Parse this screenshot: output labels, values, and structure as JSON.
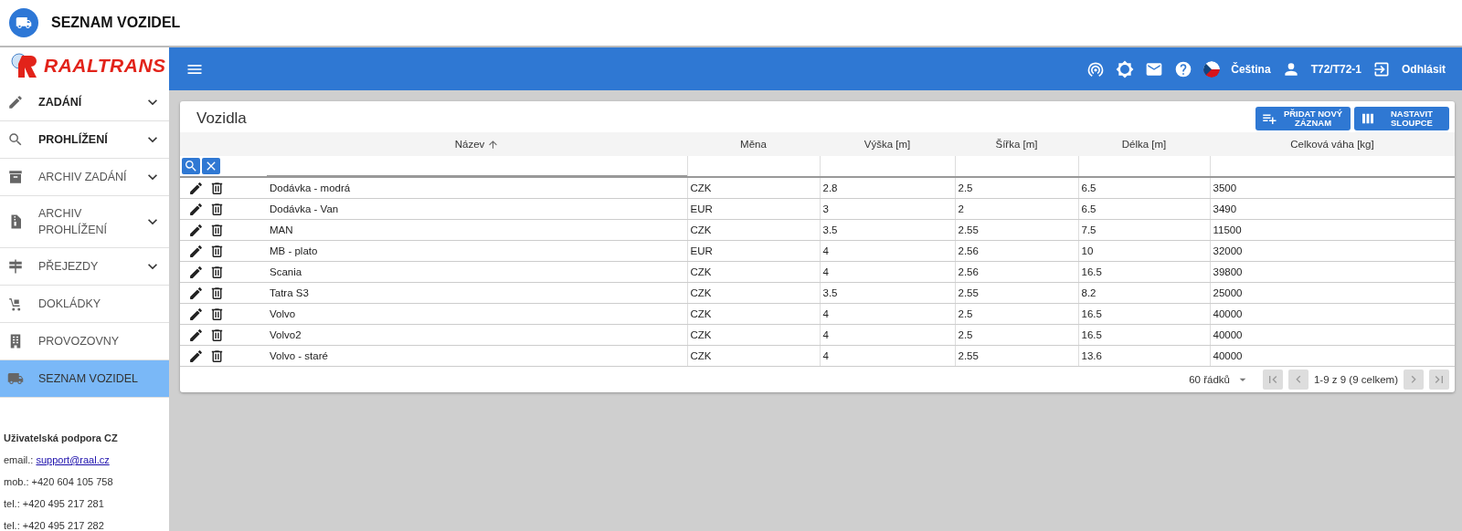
{
  "app_header": {
    "title": "SEZNAM VOZIDEL"
  },
  "sidebar": {
    "logo": "RAALTRANS",
    "items": [
      {
        "label": "ZADÁNÍ",
        "bold": true,
        "expandable": true,
        "selected": false
      },
      {
        "label": "PROHLÍŽENÍ",
        "bold": true,
        "expandable": true,
        "selected": false
      },
      {
        "label": "ARCHIV ZADÁNÍ",
        "bold": false,
        "expandable": true,
        "selected": false
      },
      {
        "label": "ARCHIV PROHLÍŽENÍ",
        "bold": false,
        "expandable": true,
        "selected": false
      },
      {
        "label": "PŘEJEZDY",
        "bold": false,
        "expandable": true,
        "selected": false
      },
      {
        "label": "DOKLÁDKY",
        "bold": false,
        "expandable": false,
        "selected": false
      },
      {
        "label": "PROVOZOVNY",
        "bold": false,
        "expandable": false,
        "selected": false
      },
      {
        "label": "SEZNAM VOZIDEL",
        "bold": false,
        "expandable": false,
        "selected": true
      }
    ],
    "support": {
      "title": "Uživatelská podpora CZ",
      "email_label": "email.:",
      "email": "support@raal.cz",
      "lines": [
        "mob.: +420 604 105 758",
        "tel.: +420 495 217 281",
        "tel.: +420 495 217 282"
      ]
    }
  },
  "topbar": {
    "language": "Čeština",
    "user": "T72/T72-1",
    "logout": "Odhlásit"
  },
  "card": {
    "title": "Vozidla",
    "buttons": [
      {
        "label": "PŘIDAT NOVÝ ZÁZNAM"
      },
      {
        "label": "NASTAVIT SLOUPCE"
      }
    ]
  },
  "table": {
    "columns": [
      {
        "label": "Název",
        "sorted": true
      },
      {
        "label": "Měna",
        "sorted": false
      },
      {
        "label": "Výška [m]",
        "sorted": false
      },
      {
        "label": "Šířka [m]",
        "sorted": false
      },
      {
        "label": "Délka [m]",
        "sorted": false
      },
      {
        "label": "Celková váha [kg]",
        "sorted": false
      }
    ],
    "rows": [
      [
        "Dodávka - modrá",
        "CZK",
        "2.8",
        "2.5",
        "6.5",
        "3500"
      ],
      [
        "Dodávka - Van",
        "EUR",
        "3",
        "2",
        "6.5",
        "3490"
      ],
      [
        "MAN",
        "CZK",
        "3.5",
        "2.55",
        "7.5",
        "11500"
      ],
      [
        "MB - plato",
        "EUR",
        "4",
        "2.56",
        "10",
        "32000"
      ],
      [
        "Scania",
        "CZK",
        "4",
        "2.56",
        "16.5",
        "39800"
      ],
      [
        "Tatra S3",
        "CZK",
        "3.5",
        "2.55",
        "8.2",
        "25000"
      ],
      [
        "Volvo",
        "CZK",
        "4",
        "2.5",
        "16.5",
        "40000"
      ],
      [
        "Volvo2",
        "CZK",
        "4",
        "2.5",
        "16.5",
        "40000"
      ],
      [
        "Volvo - staré",
        "CZK",
        "4",
        "2.55",
        "13.6",
        "40000"
      ]
    ]
  },
  "pager": {
    "rows_per_page": "60 řádků",
    "range": "1-9 z 9 (9 celkem)",
    "buttons": [
      {
        "kind": "first",
        "disabled": true
      },
      {
        "kind": "prev",
        "disabled": true
      },
      {
        "kind": "next",
        "disabled": true
      },
      {
        "kind": "last",
        "disabled": true
      }
    ]
  }
}
